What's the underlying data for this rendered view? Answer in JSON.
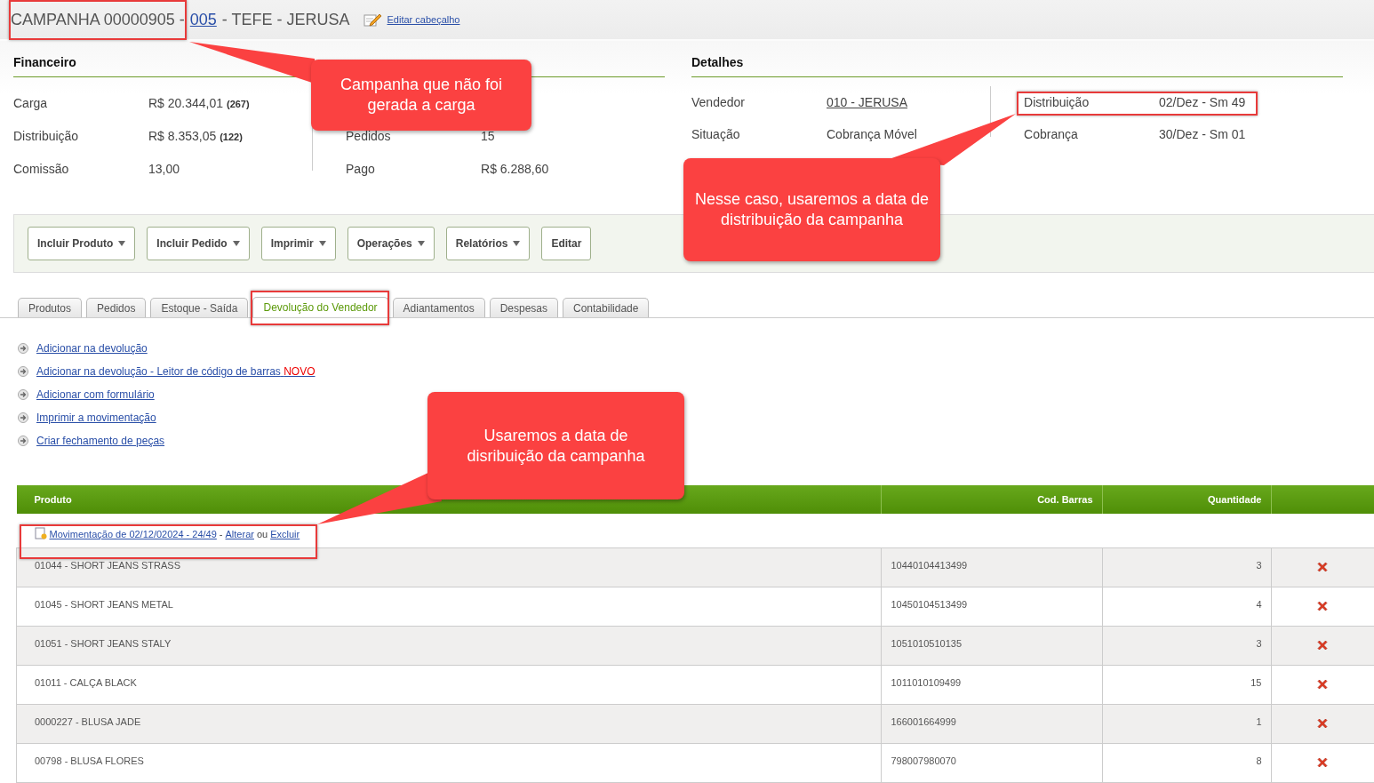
{
  "header": {
    "title": "CAMPANHA 00000905 -",
    "code_link": "005",
    "title_rest": "- TEFE - JERUSA",
    "edit_link": "Editar cabeçalho"
  },
  "financeiro": {
    "title": "Financeiro",
    "rows": [
      {
        "label": "Carga",
        "value": "R$ 20.344,01",
        "count": "(267)"
      },
      {
        "label": "Distribuição",
        "value": "R$ 8.353,05",
        "count": "(122)"
      },
      {
        "label": "Comissão",
        "value": "13,00"
      }
    ],
    "rows_2": [
      {
        "label": "Pedidos",
        "value": "15"
      },
      {
        "label": "Pago",
        "value": "R$ 6.288,60"
      }
    ]
  },
  "detalhes": {
    "title": "Detalhes",
    "rows": [
      {
        "label": "Vendedor",
        "value": "010 - JERUSA",
        "kind": "link"
      },
      {
        "label": "Situação",
        "value": "Cobrança Móvel",
        "kind": "text"
      }
    ],
    "rows_2": [
      {
        "label": "Distribuição",
        "value": "02/Dez - Sm 49"
      },
      {
        "label": "Cobrança",
        "value": "30/Dez - Sm 01"
      }
    ]
  },
  "toolbar": [
    {
      "label": "Incluir Produto",
      "dropdown": true
    },
    {
      "label": "Incluir Pedido",
      "dropdown": true
    },
    {
      "label": "Imprimir",
      "dropdown": true
    },
    {
      "label": "Operações",
      "dropdown": true
    },
    {
      "label": "Relatórios",
      "dropdown": true
    },
    {
      "label": "Editar",
      "dropdown": false
    }
  ],
  "tabs": [
    {
      "label": "Produtos",
      "selected": false
    },
    {
      "label": "Pedidos",
      "selected": false
    },
    {
      "label": "Estoque - Saída",
      "selected": false
    },
    {
      "label": "Devolução do Vendedor",
      "selected": true
    },
    {
      "label": "Adiantamentos",
      "selected": false
    },
    {
      "label": "Despesas",
      "selected": false
    },
    {
      "label": "Contabilidade",
      "selected": false
    }
  ],
  "actions": [
    {
      "label": "Adicionar na devolução"
    },
    {
      "label": "Adicionar na devolução - Leitor de código de barras",
      "badge": "NOVO"
    },
    {
      "label": "Adicionar com formulário"
    },
    {
      "label": "Imprimir a movimentação"
    },
    {
      "label": "Criar fechamento de peças"
    }
  ],
  "table": {
    "columns": [
      "Produto",
      "Cod. Barras",
      "Quantidade"
    ],
    "movement": {
      "link": "Movimentação de 02/12/02024 - 24/49",
      "separator": "-",
      "edit": "Alterar",
      "connector": "ou",
      "delete": "Excluir"
    },
    "rows": [
      {
        "produto": "01044 - SHORT JEANS STRASS",
        "cod_barras": "10440104413499",
        "quantidade": "3"
      },
      {
        "produto": "01045 - SHORT JEANS METAL",
        "cod_barras": "10450104513499",
        "quantidade": "4"
      },
      {
        "produto": "01051 - SHORT JEANS STALY",
        "cod_barras": "1051010510135",
        "quantidade": "3"
      },
      {
        "produto": "01011 - CALÇA BLACK",
        "cod_barras": "1011010109499",
        "quantidade": "15"
      },
      {
        "produto": "0000227 - BLUSA JADE",
        "cod_barras": "166001664999",
        "quantidade": "1"
      },
      {
        "produto": "00798 - BLUSA FLORES",
        "cod_barras": "798007980070",
        "quantidade": "8"
      }
    ]
  },
  "callouts": [
    {
      "text": "Campanha que não foi gerada a carga"
    },
    {
      "text": "Nesse caso, usaremos a data de distribuição da campanha"
    },
    {
      "text": "Usaremos a data de disribuição da campanha"
    }
  ]
}
